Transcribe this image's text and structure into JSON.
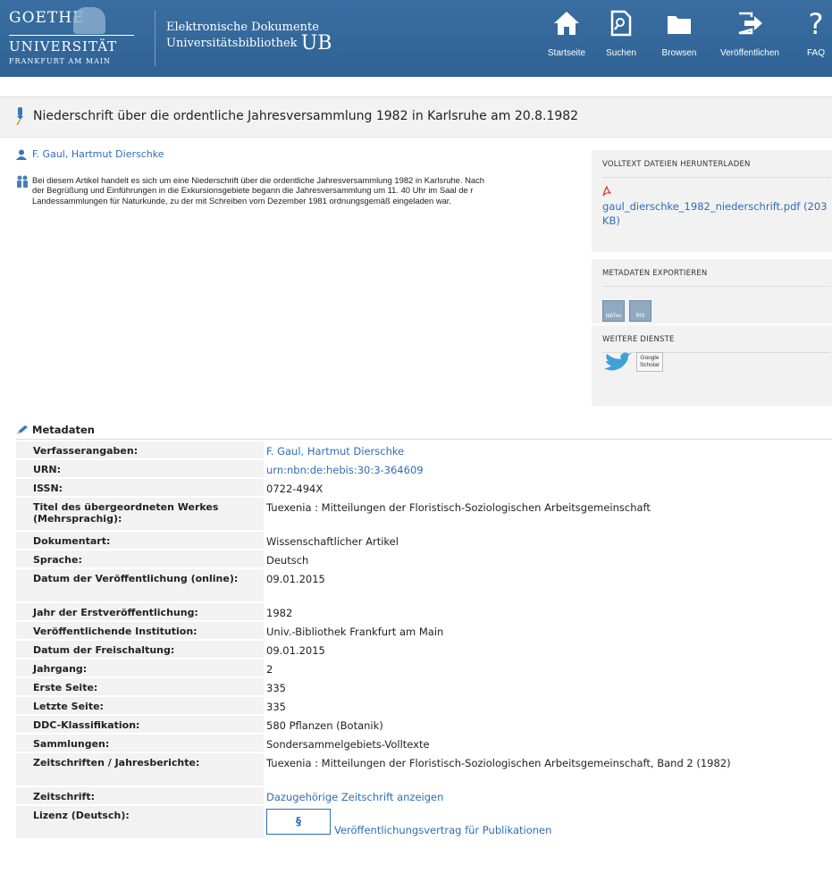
{
  "header": {
    "logo_line1": "GOETHE",
    "logo_line2": "UNIVERSITÄT",
    "logo_line3": "FRANKFURT AM MAIN",
    "site_line1": "Elektronische Dokumente",
    "site_line2": "Universitätsbibliothek",
    "site_ub": "UB",
    "nav": [
      {
        "label": "Startseite",
        "icon": "home-icon"
      },
      {
        "label": "Suchen",
        "icon": "search-icon"
      },
      {
        "label": "Browsen",
        "icon": "folder-icon"
      },
      {
        "label": "Veröffentlichen",
        "icon": "publish-icon"
      },
      {
        "label": "FAQ",
        "icon": "help-icon"
      }
    ]
  },
  "document": {
    "title": "Niederschrift über die ordentliche Jahresversammlung 1982 in Karlsruhe am 20.8.1982",
    "authors": "F. Gaul, Hartmut Dierschke",
    "abstract": "Bei diesem Artikel handelt es sich um eine Niederschrift über die ordentliche Jahresversammlung 1982 in Karlsruhe. Nach der Begrüßung und Einführungen in die Exkursionsgebiete begann die Jahresversammlung um 11. 40 Uhr im Saal de r Landessammlungen für Naturkunde, zu der mit Schreiben vom Dezember 1981 ordnungsgemäß eingeladen war."
  },
  "sidebar": {
    "download_heading": "VOLLTEXT DATEIEN HERUNTERLADEN",
    "pdf_file": "gaul_dierschke_1982_niederschrift.pdf (203 KB)",
    "export_heading": "METADATEN EXPORTIEREN",
    "export_buttons": [
      "bibTex",
      "RIS"
    ],
    "services_heading": "WEITERE DIENSTE",
    "scholar_line1": "Google",
    "scholar_line2": "Scholar"
  },
  "metadata": {
    "heading": "Metadaten",
    "rows": [
      {
        "label": "Verfasserangaben:",
        "value": "F. Gaul, Hartmut Dierschke",
        "link": true
      },
      {
        "label": "URN:",
        "value": "urn:nbn:de:hebis:30:3-364609",
        "link": true
      },
      {
        "label": "ISSN:",
        "value": "0722-494X",
        "link": false
      },
      {
        "label": "Titel des übergeordneten Werkes (Mehrsprachig):",
        "value": "Tuexenia : Mitteilungen der Floristisch-Soziologischen Arbeitsgemeinschaft",
        "link": false
      },
      {
        "label": "Dokumentart:",
        "value": "Wissenschaftlicher Artikel",
        "link": false
      },
      {
        "label": "Sprache:",
        "value": "Deutsch",
        "link": false
      },
      {
        "label": "Datum der Veröffentlichung (online):",
        "value": "09.01.2015",
        "link": false
      },
      {
        "label": "Jahr der Erstveröffentlichung:",
        "value": "1982",
        "link": false
      },
      {
        "label": "Veröffentlichende Institution:",
        "value": "Univ.-Bibliothek Frankfurt am Main",
        "link": false
      },
      {
        "label": "Datum der Freischaltung:",
        "value": "09.01.2015",
        "link": false
      },
      {
        "label": "Jahrgang:",
        "value": "2",
        "link": false
      },
      {
        "label": "Erste Seite:",
        "value": "335",
        "link": false
      },
      {
        "label": "Letzte Seite:",
        "value": "335",
        "link": false
      },
      {
        "label": "DDC-Klassifikation:",
        "value": "580 Pflanzen (Botanik)",
        "link": false
      },
      {
        "label": "Sammlungen:",
        "value": "Sondersammelgebiets-Volltexte",
        "link": false
      },
      {
        "label": "Zeitschriften / Jahresberichte:",
        "value": "Tuexenia : Mitteilungen der Floristisch-Soziologischen Arbeitsgemeinschaft, Band 2 (1982)",
        "link": false
      },
      {
        "label": "Zeitschrift:",
        "value": "Dazugehörige Zeitschrift anzeigen",
        "link": true
      },
      {
        "label": "Lizenz (Deutsch):",
        "value": "Veröffentlichungsvertrag für Publikationen",
        "link": true,
        "badge": "§"
      }
    ]
  },
  "colors": {
    "header_blue": "#336699",
    "link_blue": "#2f6db4",
    "panel_gray": "#f2f2f2"
  }
}
